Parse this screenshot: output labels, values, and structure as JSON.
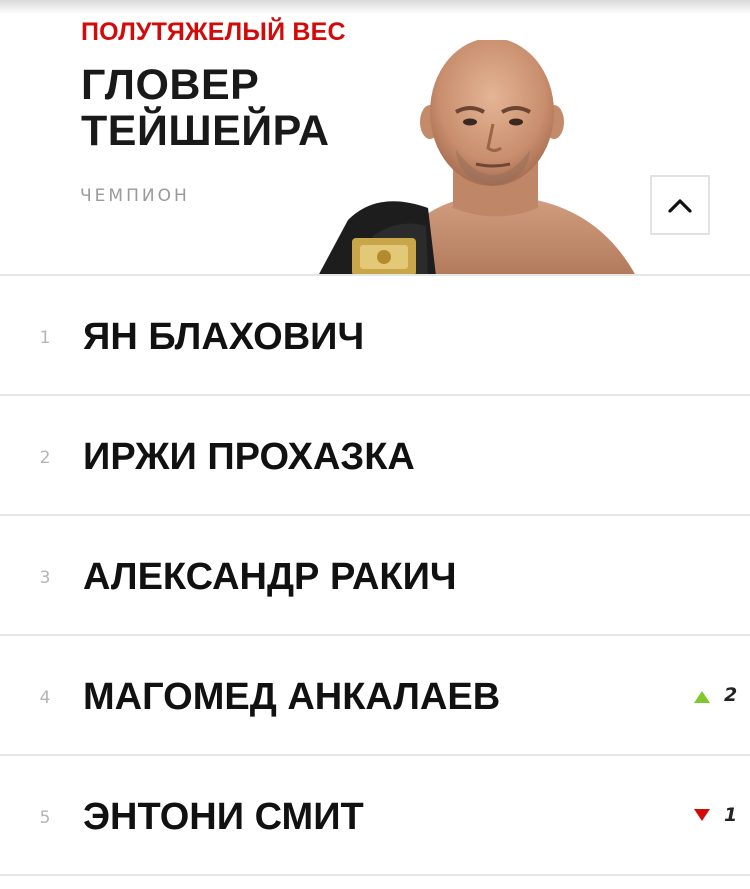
{
  "champion": {
    "division": "ПОЛУТЯЖЕЛЫЙ ВЕС",
    "name_line1": "ГЛОВЕР",
    "name_line2": "ТЕЙШЕЙРА",
    "label": "ЧЕМПИОН",
    "photo_icon": "fighter-photo-with-belt"
  },
  "collapse_icon": "chevron-up-icon",
  "rankings": [
    {
      "rank": "1",
      "name": "ЯН БЛАХОВИЧ",
      "movement": null,
      "change": ""
    },
    {
      "rank": "2",
      "name": "ИРЖИ ПРОХАЗКА",
      "movement": null,
      "change": ""
    },
    {
      "rank": "3",
      "name": "АЛЕКСАНДР РАКИЧ",
      "movement": null,
      "change": ""
    },
    {
      "rank": "4",
      "name": "МАГОМЕД АНКАЛАЕВ",
      "movement": "up",
      "change": "2"
    },
    {
      "rank": "5",
      "name": "ЭНТОНИ СМИТ",
      "movement": "down",
      "change": "1"
    }
  ],
  "colors": {
    "accent_red": "#d20a0a",
    "up_green": "#7ec82a",
    "text_dark": "#191919",
    "muted_gray": "#9a9a9a"
  }
}
